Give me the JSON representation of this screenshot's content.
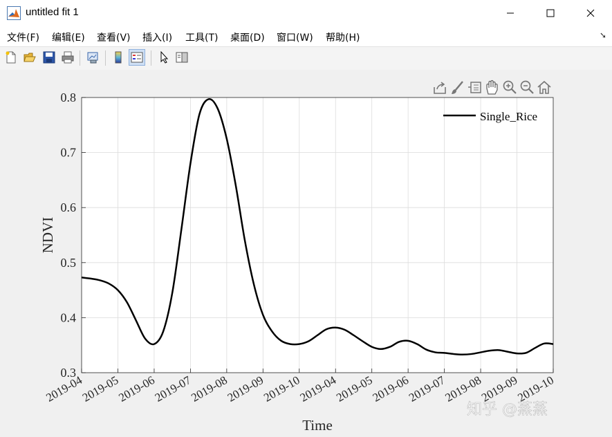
{
  "window": {
    "title": "untitled fit 1",
    "icon": "matlab-icon"
  },
  "menu": {
    "items": [
      "文件(F)",
      "编辑(E)",
      "查看(V)",
      "插入(I)",
      "工具(T)",
      "桌面(D)",
      "窗口(W)",
      "帮助(H)"
    ]
  },
  "toolbar": {
    "buttons": [
      "new-figure-icon",
      "open-icon",
      "save-icon",
      "print-icon",
      "link-plot-icon",
      "colorbar-icon",
      "legend-icon",
      "pointer-icon",
      "property-editor-icon"
    ]
  },
  "axes_toolbar": [
    "export-icon",
    "brush-icon",
    "data-tips-icon",
    "pan-icon",
    "zoom-in-icon",
    "zoom-out-icon",
    "home-icon"
  ],
  "watermark": "知乎 @蒸蒸",
  "chart_data": {
    "type": "line",
    "xlabel": "Time",
    "ylabel": "NDVI",
    "ylim": [
      0.3,
      0.8
    ],
    "yticks": [
      "0.3",
      "0.4",
      "0.5",
      "0.6",
      "0.7",
      "0.8"
    ],
    "xticks": [
      "2019-04",
      "2019-05",
      "2019-06",
      "2019-07",
      "2019-08",
      "2019-09",
      "2019-10",
      "2019-04",
      "2019-05",
      "2019-06",
      "2019-07",
      "2019-08",
      "2019-09",
      "2019-10"
    ],
    "grid": true,
    "legend": {
      "position": "top-right",
      "entries": [
        "Single_Rice"
      ]
    },
    "series": [
      {
        "name": "Single_Rice",
        "color": "#000000",
        "x": [
          0,
          0.25,
          0.5,
          0.75,
          1,
          1.25,
          1.5,
          1.75,
          2,
          2.25,
          2.5,
          2.75,
          3,
          3.25,
          3.5,
          3.75,
          4,
          4.25,
          4.5,
          4.75,
          5,
          5.25,
          5.5,
          5.75,
          6,
          6.25,
          6.5,
          6.75,
          7,
          7.25,
          7.5,
          7.75,
          8,
          8.25,
          8.5,
          8.75,
          9,
          9.25,
          9.5,
          9.75,
          10,
          10.25,
          10.5,
          10.75,
          11,
          11.25,
          11.5,
          11.75,
          12,
          12.25,
          12.5,
          12.75,
          13
        ],
        "y": [
          0.473,
          0.471,
          0.468,
          0.462,
          0.45,
          0.428,
          0.395,
          0.362,
          0.352,
          0.375,
          0.445,
          0.56,
          0.68,
          0.77,
          0.797,
          0.78,
          0.725,
          0.64,
          0.54,
          0.46,
          0.405,
          0.375,
          0.358,
          0.352,
          0.352,
          0.357,
          0.368,
          0.379,
          0.382,
          0.378,
          0.368,
          0.357,
          0.347,
          0.343,
          0.347,
          0.356,
          0.358,
          0.352,
          0.342,
          0.337,
          0.336,
          0.334,
          0.333,
          0.334,
          0.337,
          0.34,
          0.341,
          0.338,
          0.335,
          0.336,
          0.345,
          0.353,
          0.352
        ]
      }
    ]
  }
}
